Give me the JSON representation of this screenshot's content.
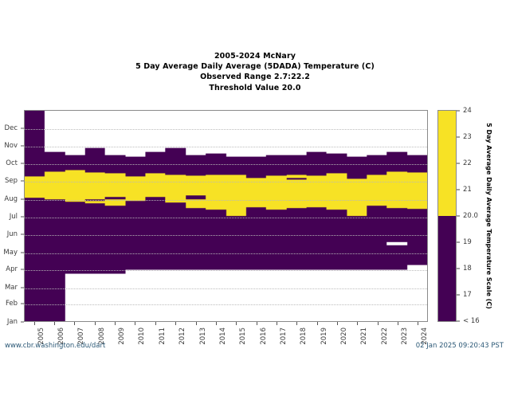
{
  "title": {
    "line1": "2005-2024 McNary",
    "line2": "5 Day Average Daily Average (5DADA) Temperature (C)",
    "line3": "Observed Range 2.7:22.2",
    "line4": "Threshold Value 20.0"
  },
  "footer": {
    "url": "www.cbr.washington.edu/dart",
    "timestamp": "02 Jan 2025 09:20:43 PST"
  },
  "colorbar": {
    "title": "5 Day Average Daily Average Temperature Scale (C)",
    "ticks": [
      "24",
      "23",
      "22",
      "21",
      "20.0",
      "19",
      "18",
      "17",
      "< 16"
    ],
    "tick_values": [
      24,
      23,
      22,
      21,
      20.0,
      19,
      18,
      17,
      16
    ],
    "vmin": 16,
    "vmax": 24,
    "threshold": 20.0,
    "above_color": "#F7E225",
    "below_color": "#440154"
  },
  "chart_data": {
    "type": "heatmap",
    "title": "2005-2024 McNary 5 Day Average Daily Average (5DADA) Temperature (C)",
    "subtitle": "Observed Range 2.7:22.2 / Threshold Value 20.0",
    "xlabel": "",
    "ylabel": "",
    "grid": true,
    "legend_position": "right",
    "observed_range": [
      2.7,
      22.2
    ],
    "threshold": 20.0,
    "colors": {
      "above_threshold": "#F7E225",
      "below_threshold": "#440154",
      "no_data": "#ffffff"
    },
    "x": [
      "2005",
      "2006",
      "2007",
      "2008",
      "2009",
      "2010",
      "2011",
      "2012",
      "2013",
      "2014",
      "2015",
      "2016",
      "2017",
      "2018",
      "2019",
      "2020",
      "2021",
      "2022",
      "2023",
      "2024"
    ],
    "y": [
      "Jan",
      "Feb",
      "Mar",
      "Apr",
      "May",
      "Jun",
      "Jul",
      "Aug",
      "Sep",
      "Oct",
      "Nov",
      "Dec"
    ],
    "y_tick_labels_top_to_bottom": [
      "Dec",
      "Nov",
      "Oct",
      "Sep",
      "Aug",
      "Jul",
      "Jun",
      "May",
      "Apr",
      "Mar",
      "Feb",
      "Jan"
    ],
    "ylim_days": [
      0,
      365
    ],
    "note": "Each year column shows the seasonal temperature band: white = no data, dark purple = below 20.0 C, yellow = at or above 20.0 C. Segments given as day-of-year start/end within each year column.",
    "series": [
      {
        "name": "2005",
        "segments": [
          {
            "state": "below",
            "start": 0,
            "end": 214
          },
          {
            "state": "above",
            "start": 214,
            "end": 251
          },
          {
            "state": "below",
            "start": 251,
            "end": 365
          }
        ]
      },
      {
        "name": "2006",
        "segments": [
          {
            "state": "below",
            "start": 0,
            "end": 212
          },
          {
            "state": "above",
            "start": 212,
            "end": 259
          },
          {
            "state": "below",
            "start": 259,
            "end": 294
          },
          {
            "state": "none",
            "start": 294,
            "end": 365
          }
        ]
      },
      {
        "name": "2007",
        "segments": [
          {
            "state": "none",
            "start": 0,
            "end": 82
          },
          {
            "state": "below",
            "start": 82,
            "end": 207
          },
          {
            "state": "above",
            "start": 207,
            "end": 262
          },
          {
            "state": "below",
            "start": 262,
            "end": 288
          },
          {
            "state": "none",
            "start": 288,
            "end": 365
          }
        ]
      },
      {
        "name": "2008",
        "segments": [
          {
            "state": "none",
            "start": 0,
            "end": 82
          },
          {
            "state": "below",
            "start": 82,
            "end": 205
          },
          {
            "state": "above",
            "start": 205,
            "end": 208
          },
          {
            "state": "below",
            "start": 208,
            "end": 212
          },
          {
            "state": "above",
            "start": 212,
            "end": 258
          },
          {
            "state": "below",
            "start": 258,
            "end": 300
          },
          {
            "state": "none",
            "start": 300,
            "end": 365
          }
        ]
      },
      {
        "name": "2009",
        "segments": [
          {
            "state": "none",
            "start": 0,
            "end": 82
          },
          {
            "state": "below",
            "start": 82,
            "end": 201
          },
          {
            "state": "above",
            "start": 201,
            "end": 212
          },
          {
            "state": "below",
            "start": 212,
            "end": 216
          },
          {
            "state": "above",
            "start": 216,
            "end": 256
          },
          {
            "state": "below",
            "start": 256,
            "end": 288
          },
          {
            "state": "none",
            "start": 288,
            "end": 365
          }
        ]
      },
      {
        "name": "2010",
        "segments": [
          {
            "state": "none",
            "start": 0,
            "end": 89
          },
          {
            "state": "below",
            "start": 89,
            "end": 208
          },
          {
            "state": "above",
            "start": 208,
            "end": 251
          },
          {
            "state": "below",
            "start": 251,
            "end": 285
          },
          {
            "state": "none",
            "start": 285,
            "end": 365
          }
        ]
      },
      {
        "name": "2011",
        "segments": [
          {
            "state": "none",
            "start": 0,
            "end": 89
          },
          {
            "state": "below",
            "start": 89,
            "end": 215
          },
          {
            "state": "above",
            "start": 215,
            "end": 256
          },
          {
            "state": "below",
            "start": 256,
            "end": 294
          },
          {
            "state": "none",
            "start": 294,
            "end": 365
          }
        ]
      },
      {
        "name": "2012",
        "segments": [
          {
            "state": "none",
            "start": 0,
            "end": 89
          },
          {
            "state": "below",
            "start": 89,
            "end": 206
          },
          {
            "state": "above",
            "start": 206,
            "end": 254
          },
          {
            "state": "below",
            "start": 254,
            "end": 300
          },
          {
            "state": "none",
            "start": 300,
            "end": 365
          }
        ]
      },
      {
        "name": "2013",
        "segments": [
          {
            "state": "none",
            "start": 0,
            "end": 89
          },
          {
            "state": "below",
            "start": 89,
            "end": 196
          },
          {
            "state": "above",
            "start": 196,
            "end": 212
          },
          {
            "state": "below",
            "start": 212,
            "end": 218
          },
          {
            "state": "above",
            "start": 218,
            "end": 253
          },
          {
            "state": "below",
            "start": 253,
            "end": 288
          },
          {
            "state": "none",
            "start": 288,
            "end": 365
          }
        ]
      },
      {
        "name": "2014",
        "segments": [
          {
            "state": "none",
            "start": 0,
            "end": 89
          },
          {
            "state": "below",
            "start": 89,
            "end": 194
          },
          {
            "state": "above",
            "start": 194,
            "end": 254
          },
          {
            "state": "below",
            "start": 254,
            "end": 291
          },
          {
            "state": "none",
            "start": 291,
            "end": 365
          }
        ]
      },
      {
        "name": "2015",
        "segments": [
          {
            "state": "none",
            "start": 0,
            "end": 89
          },
          {
            "state": "below",
            "start": 89,
            "end": 182
          },
          {
            "state": "above",
            "start": 182,
            "end": 254
          },
          {
            "state": "below",
            "start": 254,
            "end": 285
          },
          {
            "state": "none",
            "start": 285,
            "end": 365
          }
        ]
      },
      {
        "name": "2016",
        "segments": [
          {
            "state": "none",
            "start": 0,
            "end": 89
          },
          {
            "state": "below",
            "start": 89,
            "end": 197
          },
          {
            "state": "above",
            "start": 197,
            "end": 248
          },
          {
            "state": "below",
            "start": 248,
            "end": 285
          },
          {
            "state": "none",
            "start": 285,
            "end": 365
          }
        ]
      },
      {
        "name": "2017",
        "segments": [
          {
            "state": "none",
            "start": 0,
            "end": 89
          },
          {
            "state": "below",
            "start": 89,
            "end": 194
          },
          {
            "state": "above",
            "start": 194,
            "end": 253
          },
          {
            "state": "below",
            "start": 253,
            "end": 288
          },
          {
            "state": "none",
            "start": 288,
            "end": 365
          }
        ]
      },
      {
        "name": "2018",
        "segments": [
          {
            "state": "none",
            "start": 0,
            "end": 89
          },
          {
            "state": "below",
            "start": 89,
            "end": 196
          },
          {
            "state": "above",
            "start": 196,
            "end": 246
          },
          {
            "state": "below",
            "start": 246,
            "end": 249
          },
          {
            "state": "above",
            "start": 249,
            "end": 254
          },
          {
            "state": "below",
            "start": 254,
            "end": 288
          },
          {
            "state": "none",
            "start": 288,
            "end": 365
          }
        ]
      },
      {
        "name": "2019",
        "segments": [
          {
            "state": "none",
            "start": 0,
            "end": 89
          },
          {
            "state": "below",
            "start": 89,
            "end": 198
          },
          {
            "state": "above",
            "start": 198,
            "end": 252
          },
          {
            "state": "below",
            "start": 252,
            "end": 294
          },
          {
            "state": "none",
            "start": 294,
            "end": 365
          }
        ]
      },
      {
        "name": "2020",
        "segments": [
          {
            "state": "none",
            "start": 0,
            "end": 89
          },
          {
            "state": "below",
            "start": 89,
            "end": 193
          },
          {
            "state": "above",
            "start": 193,
            "end": 257
          },
          {
            "state": "below",
            "start": 257,
            "end": 291
          },
          {
            "state": "none",
            "start": 291,
            "end": 365
          }
        ]
      },
      {
        "name": "2021",
        "segments": [
          {
            "state": "none",
            "start": 0,
            "end": 89
          },
          {
            "state": "below",
            "start": 89,
            "end": 183
          },
          {
            "state": "above",
            "start": 183,
            "end": 247
          },
          {
            "state": "below",
            "start": 247,
            "end": 285
          },
          {
            "state": "none",
            "start": 285,
            "end": 365
          }
        ]
      },
      {
        "name": "2022",
        "segments": [
          {
            "state": "none",
            "start": 0,
            "end": 89
          },
          {
            "state": "below",
            "start": 89,
            "end": 200
          },
          {
            "state": "above",
            "start": 200,
            "end": 254
          },
          {
            "state": "below",
            "start": 254,
            "end": 288
          },
          {
            "state": "none",
            "start": 288,
            "end": 365
          }
        ]
      },
      {
        "name": "2023",
        "segments": [
          {
            "state": "none",
            "start": 0,
            "end": 89
          },
          {
            "state": "below",
            "start": 89,
            "end": 132
          },
          {
            "state": "none",
            "start": 132,
            "end": 137
          },
          {
            "state": "below",
            "start": 137,
            "end": 196
          },
          {
            "state": "above",
            "start": 196,
            "end": 259
          },
          {
            "state": "below",
            "start": 259,
            "end": 294
          },
          {
            "state": "none",
            "start": 294,
            "end": 365
          }
        ]
      },
      {
        "name": "2024",
        "segments": [
          {
            "state": "none",
            "start": 0,
            "end": 98
          },
          {
            "state": "below",
            "start": 98,
            "end": 195
          },
          {
            "state": "above",
            "start": 195,
            "end": 258
          },
          {
            "state": "below",
            "start": 258,
            "end": 288
          },
          {
            "state": "none",
            "start": 288,
            "end": 365
          }
        ]
      }
    ]
  }
}
